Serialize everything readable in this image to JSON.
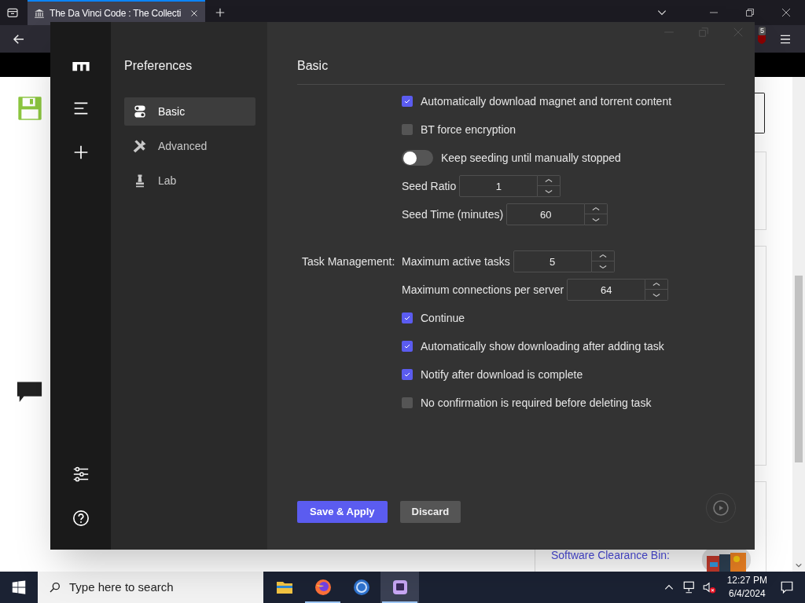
{
  "browser": {
    "tab_title": "The Da Vinci Code : The Collecti",
    "extension_badge": "5"
  },
  "web_page": {
    "link": "Software Clearance Bin:"
  },
  "app": {
    "sidebar_title": "Preferences",
    "nav_items": [
      {
        "label": "Basic",
        "kind": "toggles",
        "selected": true
      },
      {
        "label": "Advanced",
        "kind": "tools",
        "selected": false
      },
      {
        "label": "Lab",
        "kind": "flask",
        "selected": false
      }
    ],
    "section_title": "Basic",
    "groups": [
      {
        "rows": [
          {
            "kind": "checkbox",
            "label": "Automatically download magnet and torrent content",
            "checked": true
          },
          {
            "kind": "checkbox",
            "label": "BT force encryption",
            "checked": false
          },
          {
            "kind": "switch",
            "label": "Keep seeding until manually stopped",
            "on": false
          },
          {
            "kind": "number",
            "label": "Seed Ratio",
            "value": "1"
          },
          {
            "kind": "number",
            "label": "Seed Time (minutes)",
            "value": "60"
          }
        ]
      },
      {
        "label": "Task Management:",
        "rows": [
          {
            "kind": "number",
            "label": "Maximum active tasks",
            "value": "5"
          },
          {
            "kind": "number",
            "label": "Maximum connections per server",
            "value": "64"
          },
          {
            "kind": "checkbox",
            "label": "Continue",
            "checked": true
          },
          {
            "kind": "checkbox",
            "label": "Automatically show downloading after adding task",
            "checked": true
          },
          {
            "kind": "checkbox",
            "label": "Notify after download is complete",
            "checked": true
          },
          {
            "kind": "checkbox",
            "label": "No confirmation is required before deleting task",
            "checked": false
          }
        ]
      }
    ],
    "buttons": [
      {
        "label": "Save & Apply",
        "kind": "primary"
      },
      {
        "label": "Discard",
        "kind": "secondary"
      }
    ]
  },
  "taskbar": {
    "search_placeholder": "Type here to search",
    "apps": [
      {
        "kind": "files",
        "running": false,
        "selected": false
      },
      {
        "kind": "firefox",
        "running": true,
        "selected": false
      },
      {
        "kind": "browser",
        "running": false,
        "selected": false
      },
      {
        "kind": "downloader",
        "running": true,
        "selected": true
      }
    ],
    "time": "12:27 PM",
    "date": "6/4/2024"
  }
}
